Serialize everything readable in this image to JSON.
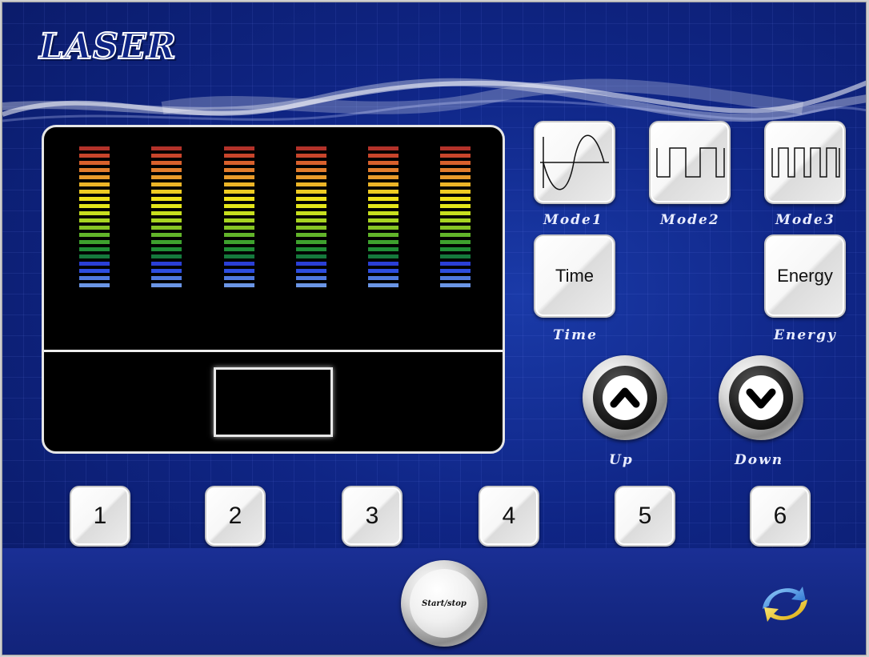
{
  "header": {
    "title": "LASER"
  },
  "modes": [
    {
      "label": "Mode1",
      "icon": "sine-wave-icon"
    },
    {
      "label": "Mode2",
      "icon": "square-wave-icon"
    },
    {
      "label": "Mode3",
      "icon": "fast-square-wave-icon"
    }
  ],
  "time_button": {
    "button_label": "Time",
    "caption": "Time"
  },
  "energy_button": {
    "button_label": "Energy",
    "caption": "Energy"
  },
  "up_button": {
    "caption": "Up",
    "icon": "chevron-up-icon"
  },
  "down_button": {
    "caption": "Down",
    "icon": "chevron-down-icon"
  },
  "channels": [
    "1",
    "2",
    "3",
    "4",
    "5",
    "6"
  ],
  "start_button": {
    "label": "Start/stop"
  },
  "footer": {
    "icon": "refresh-icon"
  },
  "meter": {
    "column_count": 6,
    "segment_colors": [
      "#b3322a",
      "#c8452b",
      "#d8602c",
      "#e27d2c",
      "#e99b2a",
      "#edb527",
      "#efcb22",
      "#efe11a",
      "#e3e51a",
      "#c7df1e",
      "#a7d421",
      "#86c524",
      "#62b42a",
      "#3ea12e",
      "#1f8d35",
      "#15793c",
      "#2a3fd6",
      "#2d4ee0",
      "#4f79e0",
      "#6a95e6"
    ]
  },
  "colors": {
    "background": "#0f2585",
    "footer": "#162a88",
    "caption": "#e8ecff"
  }
}
